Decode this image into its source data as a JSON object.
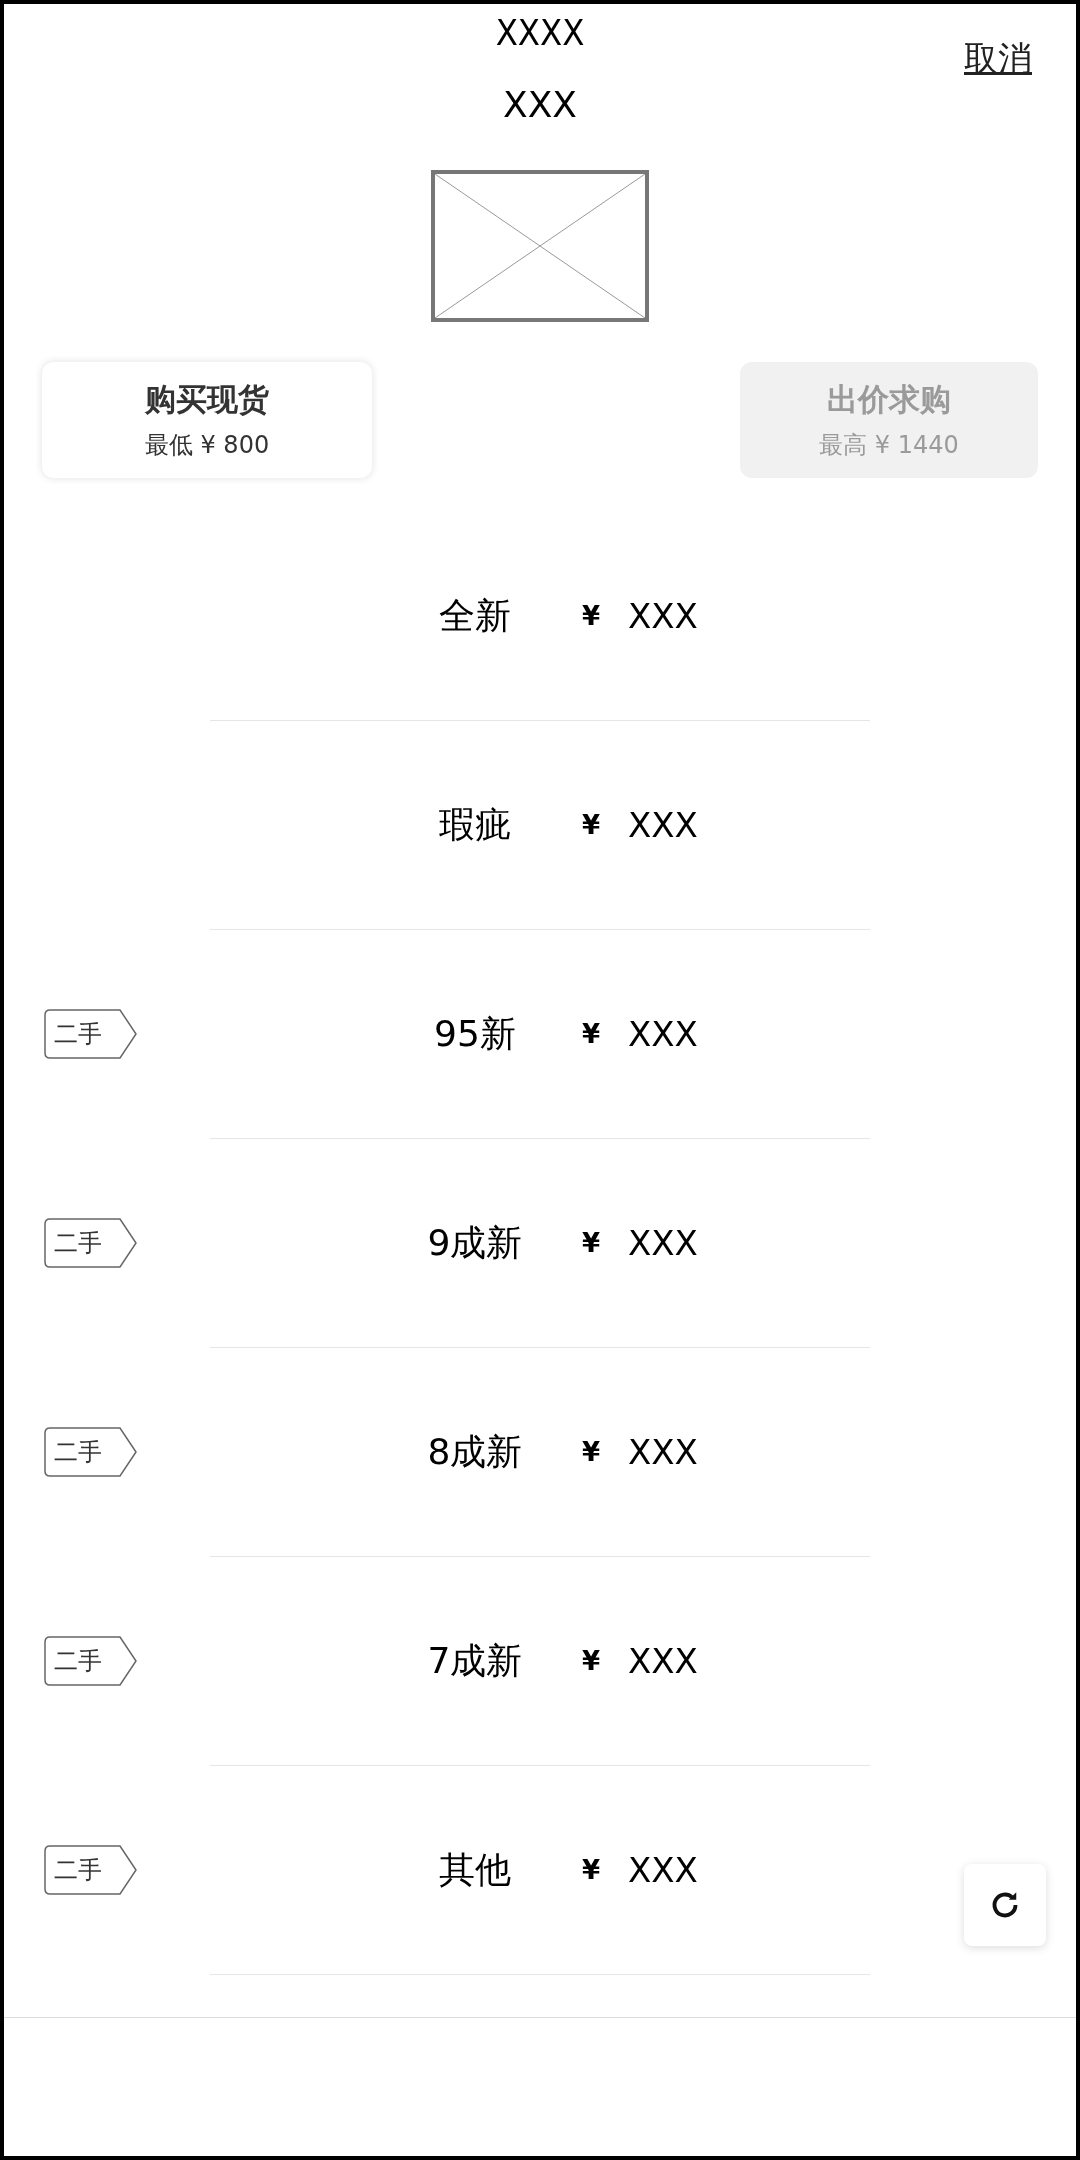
{
  "header": {
    "title": "XXXX",
    "subtitle": "XXX",
    "cancel": "取消"
  },
  "image": {
    "kind": "placeholder"
  },
  "tabs": [
    {
      "label": "购买现货",
      "price": "最低 ¥ 800",
      "selected": true
    },
    {
      "label": "出价求购",
      "price": "最高 ¥ 1440",
      "selected": false
    }
  ],
  "conditions": [
    {
      "name": "全新",
      "currency": "¥",
      "price": "XXX"
    },
    {
      "name": "瑕疵",
      "currency": "¥",
      "price": "XXX"
    },
    {
      "name": "95新",
      "currency": "¥",
      "price": "XXX",
      "tag": "二手"
    },
    {
      "name": "9成新",
      "currency": "¥",
      "price": "XXX",
      "tag": "二手"
    },
    {
      "name": "8成新",
      "currency": "¥",
      "price": "XXX",
      "tag": "二手"
    },
    {
      "name": "7成新",
      "currency": "¥",
      "price": "XXX",
      "tag": "二手"
    },
    {
      "name": "其他",
      "currency": "¥",
      "price": "XXX",
      "tag": "二手"
    }
  ]
}
